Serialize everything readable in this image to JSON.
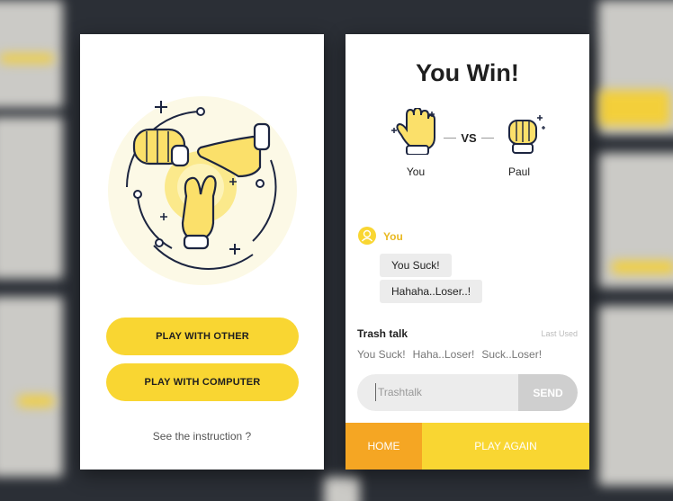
{
  "colors": {
    "accent_yellow": "#f9d632",
    "accent_orange": "#f5a623",
    "chat_sender": "#e9b922",
    "bubble_bg": "#ececec",
    "send_bg": "#cfcfcf"
  },
  "menu_screen": {
    "illustration": "rock-paper-scissors-hands-illustration",
    "play_with_other": "PLAY WITH OTHER",
    "play_with_computer": "PLAY WITH COMPUTER",
    "instruction_link": "See the instruction ?"
  },
  "result_screen": {
    "title": "You Win!",
    "vs_label": "VS",
    "player": {
      "name": "You",
      "hand_icon": "paper-hand-icon"
    },
    "opponent": {
      "name": "Paul",
      "hand_icon": "rock-fist-icon"
    },
    "chat": {
      "sender": "You",
      "messages": [
        "You Suck!",
        "Hahaha..Loser..!"
      ]
    },
    "trash_talk": {
      "title": "Trash talk",
      "last_used": "Last Used",
      "suggestions": [
        "You Suck!",
        "Haha..Loser!",
        "Suck..Loser!"
      ],
      "input_placeholder": "Trashtalk",
      "send_label": "SEND"
    },
    "home_label": "HOME",
    "play_again_label": "PLAY AGAIN"
  }
}
